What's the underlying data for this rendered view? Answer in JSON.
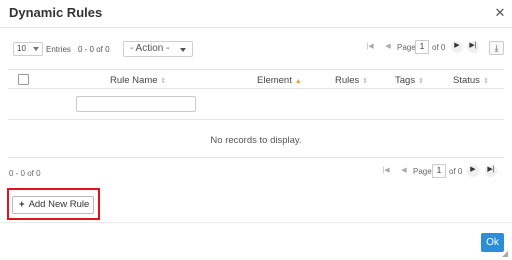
{
  "dialog": {
    "title": "Dynamic Rules",
    "close_icon": "close-icon"
  },
  "toolbar": {
    "page_size": "10",
    "entries_label": "Entries",
    "range": "0 - 0 of 0",
    "action_select": "- Action -",
    "pager": {
      "page_label": "Page",
      "page_value": "1",
      "of_label": "of 0",
      "icons": [
        "first-page-icon",
        "prev-page-icon",
        "next-page-icon",
        "last-page-icon"
      ]
    },
    "export_icon": "download-icon"
  },
  "grid": {
    "columns": [
      {
        "label": "Rule Name",
        "sort": "both"
      },
      {
        "label": "Element",
        "sort": "asc"
      },
      {
        "label": "Rules",
        "sort": "both"
      },
      {
        "label": "Tags",
        "sort": "both"
      },
      {
        "label": "Status",
        "sort": "both"
      }
    ],
    "filter_value": "",
    "empty_message": "No records to display.",
    "sort_icons": {
      "both": "⇕",
      "asc": "▲"
    }
  },
  "footer": {
    "range": "0 - 0 of 0",
    "pager": {
      "page_label": "Page",
      "page_value": "1",
      "of_label": "of 0"
    }
  },
  "actions": {
    "add_rule_label": "Add New Rule",
    "ok_label": "Ok"
  },
  "colors": {
    "accent": "#2b8ed9",
    "highlight": "#e0141e",
    "sort_active": "#f0a020"
  }
}
